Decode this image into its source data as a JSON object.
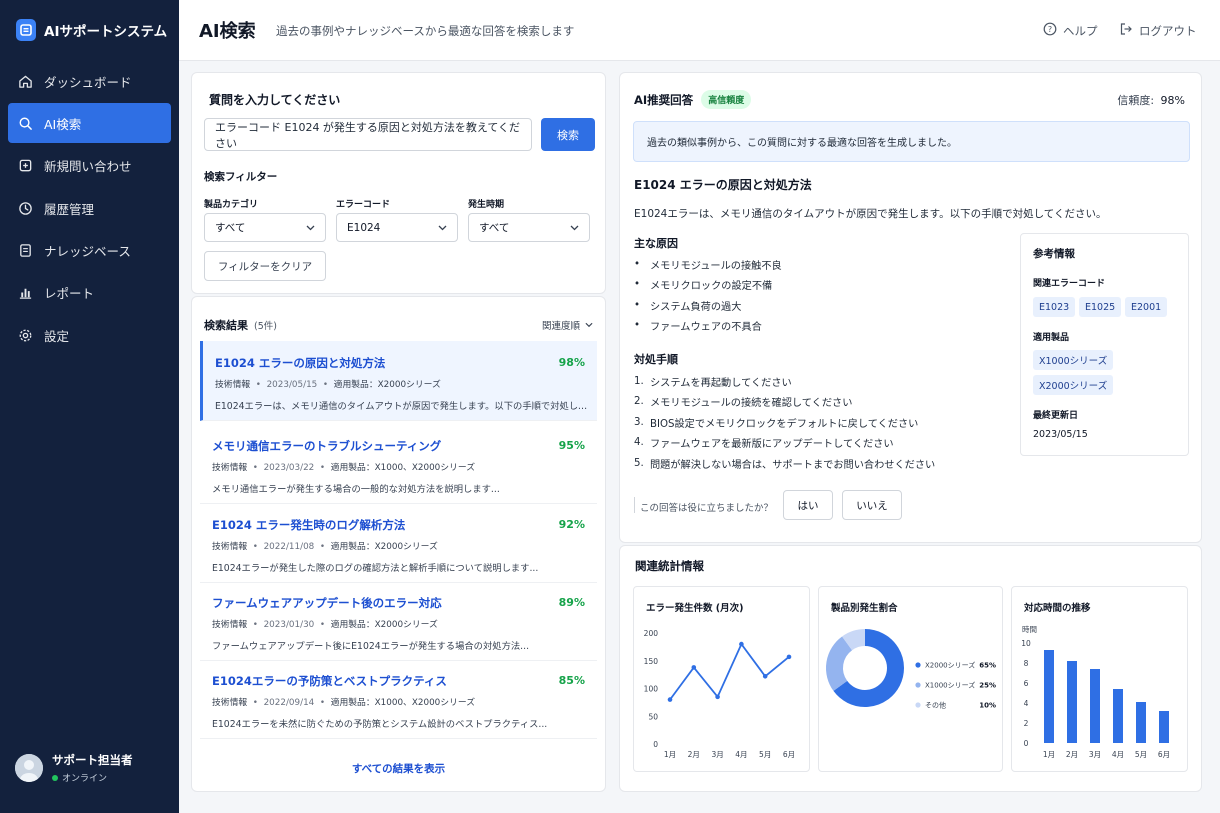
{
  "app": {
    "name": "AIサポートシステム"
  },
  "sidebar": {
    "items": [
      {
        "label": "ダッシュボード",
        "icon": "home-icon",
        "active": false
      },
      {
        "label": "AI検索",
        "icon": "search-icon",
        "active": true
      },
      {
        "label": "新規問い合わせ",
        "icon": "new-ticket-icon",
        "active": false
      },
      {
        "label": "履歴管理",
        "icon": "clock-icon",
        "active": false
      },
      {
        "label": "ナレッジベース",
        "icon": "document-icon",
        "active": false
      },
      {
        "label": "レポート",
        "icon": "bar-chart-icon",
        "active": false
      },
      {
        "label": "設定",
        "icon": "gear-icon",
        "active": false
      }
    ],
    "user": {
      "name": "サポート担当者",
      "status": "オンライン"
    }
  },
  "header": {
    "title": "AI検索",
    "subtitle": "過去の事例やナレッジベースから最適な回答を検索します",
    "help": "ヘルプ",
    "logout": "ログアウト"
  },
  "query": {
    "title": "質問を入力してください",
    "value": "エラーコード E1024 が発生する原因と対処方法を教えてください",
    "button": "検索",
    "filters_title": "検索フィルター",
    "filters": [
      {
        "label": "製品カテゴリ",
        "value": "すべて"
      },
      {
        "label": "エラーコード",
        "value": "E1024"
      },
      {
        "label": "発生時期",
        "value": "すべて"
      }
    ],
    "clear": "フィルターをクリア"
  },
  "results": {
    "title": "検索結果",
    "count": "(5件)",
    "sort": "関連度順",
    "show_all": "すべての結果を表示",
    "items": [
      {
        "title": "E1024 エラーの原因と対処方法",
        "score": "98%",
        "type": "技術情報",
        "date": "2023/05/15",
        "product": "適用製品：X2000シリーズ",
        "desc": "E1024エラーは、メモリ通信のタイムアウトが原因で発生します。以下の手順で対処してください..."
      },
      {
        "title": "メモリ通信エラーのトラブルシューティング",
        "score": "95%",
        "type": "技術情報",
        "date": "2023/03/22",
        "product": "適用製品：X1000、X2000シリーズ",
        "desc": "メモリ通信エラーが発生する場合の一般的な対処方法を説明します..."
      },
      {
        "title": "E1024 エラー発生時のログ解析方法",
        "score": "92%",
        "type": "技術情報",
        "date": "2022/11/08",
        "product": "適用製品：X2000シリーズ",
        "desc": "E1024エラーが発生した際のログの確認方法と解析手順について説明します..."
      },
      {
        "title": "ファームウェアアップデート後のエラー対応",
        "score": "89%",
        "type": "技術情報",
        "date": "2023/01/30",
        "product": "適用製品：X2000シリーズ",
        "desc": "ファームウェアアップデート後にE1024エラーが発生する場合の対処方法..."
      },
      {
        "title": "E1024エラーの予防策とベストプラクティス",
        "score": "85%",
        "type": "技術情報",
        "date": "2022/09/14",
        "product": "適用製品：X1000、X2000シリーズ",
        "desc": "E1024エラーを未然に防ぐための予防策とシステム設計のベストプラクティス..."
      }
    ]
  },
  "answer": {
    "title": "AI推奨回答",
    "badge": "高信頼度",
    "confidence_label": "信頼度:",
    "confidence": "98%",
    "notice": "過去の類似事例から、この質問に対する最適な回答を生成しました。",
    "heading": "E1024 エラーの原因と対処方法",
    "intro": "E1024エラーは、メモリ通信のタイムアウトが原因で発生します。以下の手順で対処してください。",
    "causes_title": "主な原因",
    "causes": [
      "メモリモジュールの接触不良",
      "メモリクロックの設定不備",
      "システム負荷の過大",
      "ファームウェアの不具合"
    ],
    "steps_title": "対処手順",
    "steps": [
      "システムを再起動してください",
      "メモリモジュールの接続を確認してください",
      "BIOS設定でメモリクロックをデフォルトに戻してください",
      "ファームウェアを最新版にアップデートしてください",
      "問題が解決しない場合は、サポートまでお問い合わせください"
    ],
    "step_nums": [
      "1.",
      "2.",
      "3.",
      "4.",
      "5."
    ],
    "feedback_q": "この回答は役に立ちましたか？",
    "yes": "はい",
    "no": "いいえ",
    "ref": {
      "title": "参考情報",
      "codes_label": "関連エラーコード",
      "codes": [
        "E1023",
        "E1025",
        "E2001"
      ],
      "products_label": "適用製品",
      "products": [
        "X1000シリーズ",
        "X2000シリーズ"
      ],
      "updated_label": "最終更新日",
      "updated": "2023/05/15"
    }
  },
  "stats": {
    "title": "関連統計情報"
  },
  "chart_data": [
    {
      "type": "line",
      "title": "エラー発生件数 (月次)",
      "categories": [
        "1月",
        "2月",
        "3月",
        "4月",
        "5月",
        "6月"
      ],
      "values": [
        80,
        138,
        85,
        180,
        122,
        157
      ],
      "ylim": [
        0,
        200
      ],
      "yticks": [
        "0",
        "50",
        "100",
        "150",
        "200"
      ],
      "color": "#2f6fe4"
    },
    {
      "type": "pie",
      "title": "製品別発生割合",
      "labels": [
        "X2000シリーズ",
        "X1000シリーズ",
        "その他"
      ],
      "values": [
        65,
        25,
        10
      ],
      "value_labels": [
        "65%",
        "25%",
        "10%"
      ],
      "colors": [
        "#2f6fe4",
        "#94b4ef",
        "#c9d8f6"
      ]
    },
    {
      "type": "bar",
      "title": "対応時間の推移",
      "ylabel": "時間",
      "categories": [
        "1月",
        "2月",
        "3月",
        "4月",
        "5月",
        "6月"
      ],
      "values": [
        9.3,
        8.2,
        7.4,
        5.4,
        4.1,
        3.2
      ],
      "ylim": [
        0,
        10
      ],
      "yticks": [
        "0",
        "2",
        "4",
        "6",
        "8",
        "10"
      ],
      "color": "#2f6fe4"
    }
  ]
}
